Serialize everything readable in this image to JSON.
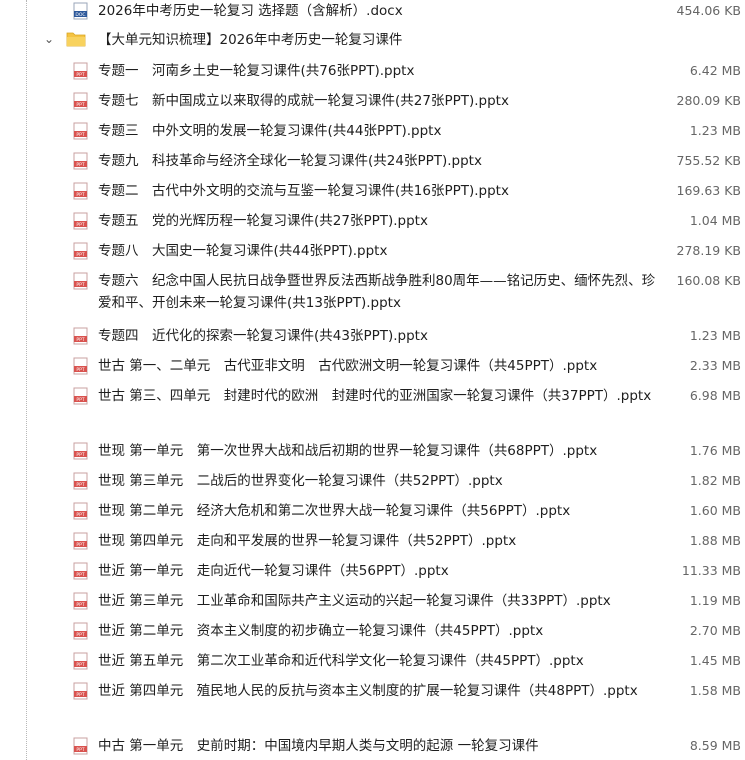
{
  "top_file": {
    "name": "2026年中考历史一轮复习 选择题（含解析）.docx",
    "size": "454.06 KB",
    "icon": "docx-icon"
  },
  "folder": {
    "name": "【大单元知识梳理】2026年中考历史一轮复习课件",
    "expanded": true,
    "icon": "folder-icon"
  },
  "files": [
    {
      "name": "专题一　河南乡土史一轮复习课件(共76张PPT).pptx",
      "size": "6.42 MB"
    },
    {
      "name": "专题七　新中国成立以来取得的成就一轮复习课件(共27张PPT).pptx",
      "size": "280.09 KB"
    },
    {
      "name": "专题三　中外文明的发展一轮复习课件(共44张PPT).pptx",
      "size": "1.23 MB"
    },
    {
      "name": "专题九　科技革命与经济全球化一轮复习课件(共24张PPT).pptx",
      "size": "755.52 KB"
    },
    {
      "name": "专题二　古代中外文明的交流与互鉴一轮复习课件(共16张PPT).pptx",
      "size": "169.63 KB"
    },
    {
      "name": "专题五　党的光辉历程一轮复习课件(共27张PPT).pptx",
      "size": "1.04 MB"
    },
    {
      "name": "专题八　大国史一轮复习课件(共44张PPT).pptx",
      "size": "278.19 KB"
    },
    {
      "name": "专题六　纪念中国人民抗日战争暨世界反法西斯战争胜利80周年——铭记历史、缅怀先烈、珍爱和平、开创未来一轮复习课件(共13张PPT).pptx",
      "size": "160.08 KB"
    },
    {
      "name": "专题四　近代化的探索一轮复习课件(共43张PPT).pptx",
      "size": "1.23 MB"
    },
    {
      "name": "世古 第一、二单元　古代亚非文明　古代欧洲文明一轮复习课件（共45PPT）.pptx",
      "size": "2.33 MB"
    },
    {
      "name": "世古 第三、四单元　封建时代的欧洲　封建时代的亚洲国家一轮复习课件（共37PPT）.pptx",
      "size": "6.98 MB"
    },
    {
      "name": "世现 第一单元　第一次世界大战和战后初期的世界一轮复习课件（共68PPT）.pptx",
      "size": "1.76 MB"
    },
    {
      "name": "世现 第三单元　二战后的世界变化一轮复习课件（共52PPT）.pptx",
      "size": "1.82 MB"
    },
    {
      "name": "世现 第二单元　经济大危机和第二次世界大战一轮复习课件（共56PPT）.pptx",
      "size": "1.60 MB"
    },
    {
      "name": "世现 第四单元　走向和平发展的世界一轮复习课件（共52PPT）.pptx",
      "size": "1.88 MB"
    },
    {
      "name": "世近 第一单元　走向近代一轮复习课件（共56PPT）.pptx",
      "size": "11.33 MB"
    },
    {
      "name": "世近 第三单元　工业革命和国际共产主义运动的兴起一轮复习课件（共33PPT）.pptx",
      "size": "1.19 MB"
    },
    {
      "name": "世近 第二单元　资本主义制度的初步确立一轮复习课件（共45PPT）.pptx",
      "size": "2.70 MB"
    },
    {
      "name": "世近 第五单元　第二次工业革命和近代科学文化一轮复习课件（共45PPT）.pptx",
      "size": "1.45 MB"
    },
    {
      "name": "世近 第四单元　殖民地人民的反抗与资本主义制度的扩展一轮复习课件（共48PPT）.pptx",
      "size": "1.58 MB"
    },
    {
      "name": "中古 第一单元　史前时期：中国境内早期人类与文明的起源 一轮复习课件",
      "size": "8.59 MB"
    }
  ],
  "file_icon": "pptx-icon",
  "colors": {
    "pptx_icon": "#d9534f",
    "docx_icon": "#2b579a",
    "folder": "#f5c342",
    "size_text": "#666666"
  }
}
